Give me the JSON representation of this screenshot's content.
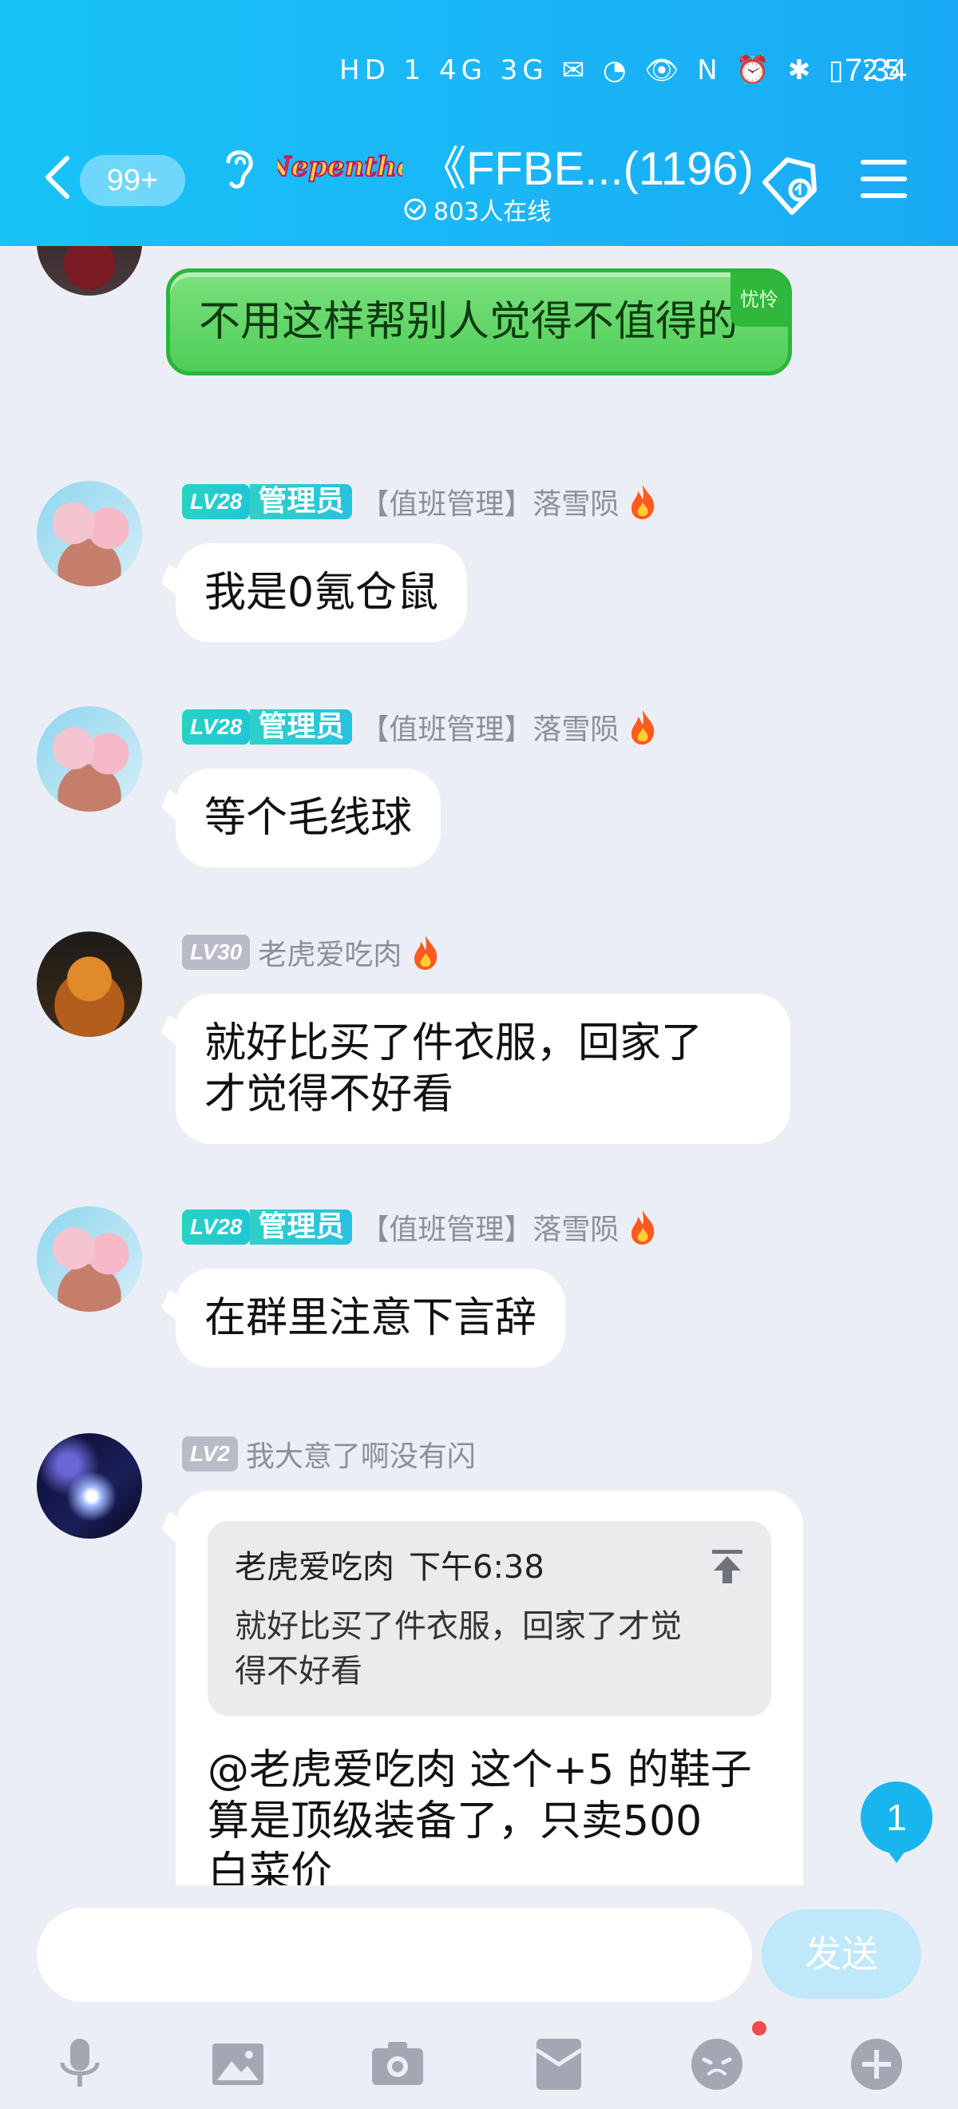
{
  "status_bar": {
    "icons_text": "HD 1 4G 3G ✉ ◔ 👁 N ⏰ ✱ ▯ 25",
    "time": "7:34"
  },
  "header": {
    "unread_count": "99+",
    "group_name": "《FFBE...(1196)",
    "logo_text": "Nepenthe",
    "online_text": "803人在线"
  },
  "messages": [
    {
      "avatar": "dark-avatar",
      "text": "不用这样帮别人觉得不值得的",
      "bubble_tag": "忧怜",
      "style": "green"
    },
    {
      "avatar": "girls-avatar",
      "level": "LV28",
      "role": "管理员",
      "name": "【值班管理】落雪陨",
      "text": "我是0氪仓鼠"
    },
    {
      "avatar": "girls-avatar",
      "level": "LV28",
      "role": "管理员",
      "name": "【值班管理】落雪陨",
      "text": "等个毛线球"
    },
    {
      "avatar": "tiger-avatar",
      "level": "LV30",
      "name": "老虎爱吃肉",
      "text_line1": "就好比买了件衣服，回家了",
      "text_line2": "才觉得不好看"
    },
    {
      "avatar": "girls-avatar",
      "level": "LV28",
      "role": "管理员",
      "name": "【值班管理】落雪陨",
      "text": "在群里注意下言辞"
    },
    {
      "avatar": "galaxy-avatar",
      "level": "LV2",
      "name": "我大意了啊没有闪",
      "quote": {
        "author": "老虎爱吃肉",
        "time": "下午6:38",
        "line1": "就好比买了件衣服，回家了才觉",
        "line2": "得不好看"
      },
      "text_line1": "@老虎爱吃肉 这个+5 的鞋子",
      "text_line2": "算是顶级装备了，只卖500",
      "text_line3": "白菜价"
    }
  ],
  "new_message_badge": "1",
  "input": {
    "placeholder": "",
    "send_label": "发送"
  },
  "toolbar": [
    "microphone-icon",
    "image-icon",
    "camera-icon",
    "red-packet-icon",
    "emoji-icon",
    "plus-icon"
  ],
  "colors": {
    "header": "#18c3f7",
    "admin_badge": "#27d3c4",
    "send_disabled": "#bfe8fa",
    "green_bubble": "#4fce58"
  }
}
